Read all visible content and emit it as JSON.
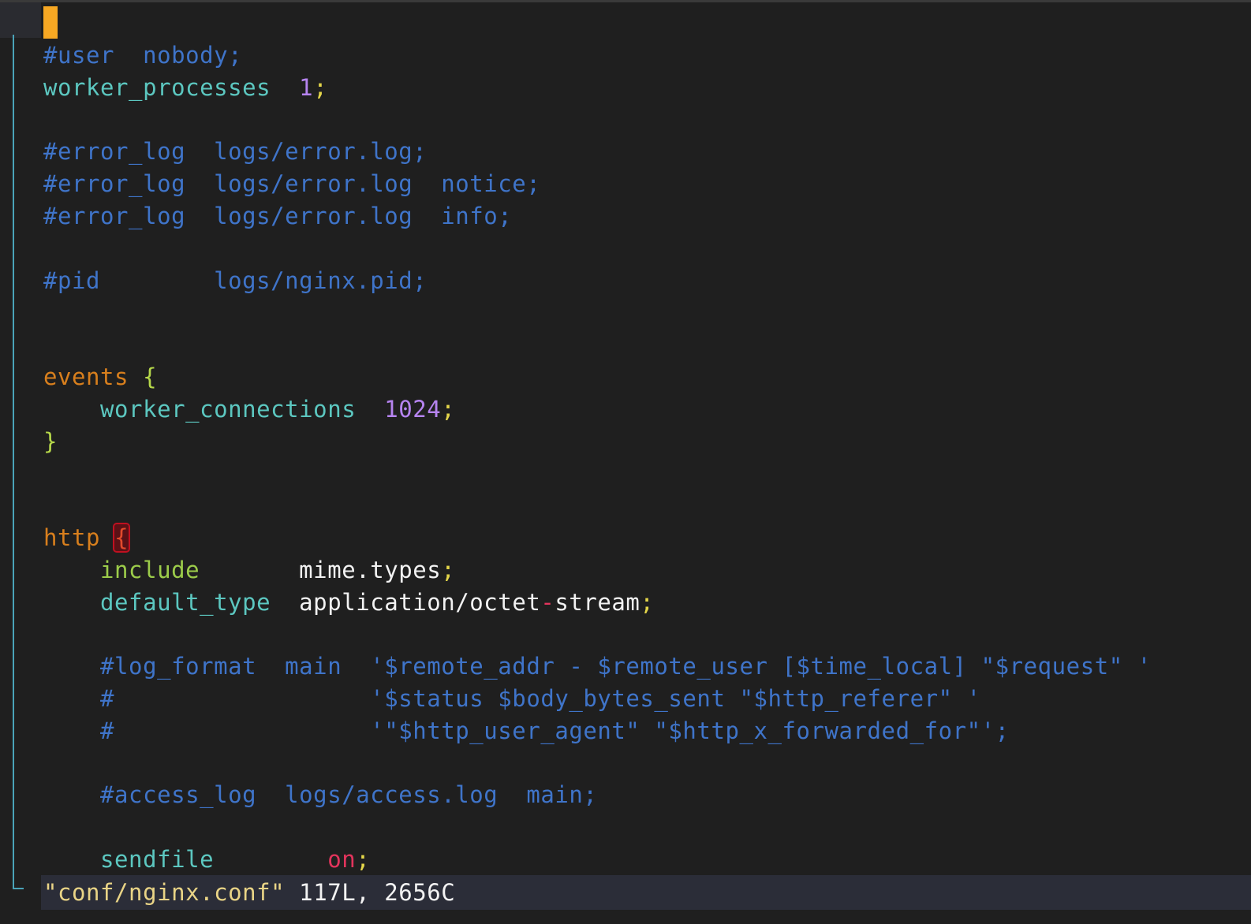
{
  "editor": {
    "lines": [
      [
        {
          "t": "#user  nobody;",
          "c": "c-comment"
        }
      ],
      [
        {
          "t": "worker_processes  ",
          "c": "c-key"
        },
        {
          "t": "1",
          "c": "c-num"
        },
        {
          "t": ";",
          "c": "c-sem"
        }
      ],
      [],
      [
        {
          "t": "#error_log  logs/error.log;",
          "c": "c-comment"
        }
      ],
      [
        {
          "t": "#error_log  logs/error.log  notice;",
          "c": "c-comment"
        }
      ],
      [
        {
          "t": "#error_log  logs/error.log  info;",
          "c": "c-comment"
        }
      ],
      [],
      [
        {
          "t": "#pid        logs/nginx.pid;",
          "c": "c-comment"
        }
      ],
      [],
      [],
      [
        {
          "t": "events ",
          "c": "c-block"
        },
        {
          "t": "{",
          "c": "c-brace"
        }
      ],
      [
        {
          "t": "    worker_connections  ",
          "c": "c-key"
        },
        {
          "t": "1024",
          "c": "c-num"
        },
        {
          "t": ";",
          "c": "c-sem"
        }
      ],
      [
        {
          "t": "}",
          "c": "c-brace"
        }
      ],
      [],
      [],
      [
        {
          "t": "http ",
          "c": "c-block"
        },
        {
          "t": "{",
          "c": "brace-hl"
        }
      ],
      [
        {
          "t": "    include       ",
          "c": "c-incl"
        },
        {
          "t": "mime.types",
          "c": "c-val"
        },
        {
          "t": ";",
          "c": "c-sem"
        }
      ],
      [
        {
          "t": "    default_type  ",
          "c": "c-key"
        },
        {
          "t": "application/octet",
          "c": "c-val"
        },
        {
          "t": "-",
          "c": "c-op"
        },
        {
          "t": "stream",
          "c": "c-val"
        },
        {
          "t": ";",
          "c": "c-sem"
        }
      ],
      [],
      [
        {
          "t": "    #log_format  main  '$remote_addr - $remote_user [$time_local] \"$request\" '",
          "c": "c-comment"
        }
      ],
      [
        {
          "t": "    #                  '$status $body_bytes_sent \"$http_referer\" '",
          "c": "c-comment"
        }
      ],
      [
        {
          "t": "    #                  '\"$http_user_agent\" \"$http_x_forwarded_for\"';",
          "c": "c-comment"
        }
      ],
      [],
      [
        {
          "t": "    #access_log  logs/access.log  main;",
          "c": "c-comment"
        }
      ],
      [],
      [
        {
          "t": "    sendfile        ",
          "c": "c-key"
        },
        {
          "t": "on",
          "c": "c-on"
        },
        {
          "t": ";",
          "c": "c-sem"
        }
      ]
    ]
  },
  "statusbar": {
    "filename": "\"conf/nginx.conf\"",
    "info": " 117L, 2656C"
  },
  "colors": {
    "background": "#1f1f1f",
    "cursor": "#f7a823",
    "comment": "#3f74c9",
    "keyword": "#5cc7c0",
    "number": "#b684f0"
  }
}
